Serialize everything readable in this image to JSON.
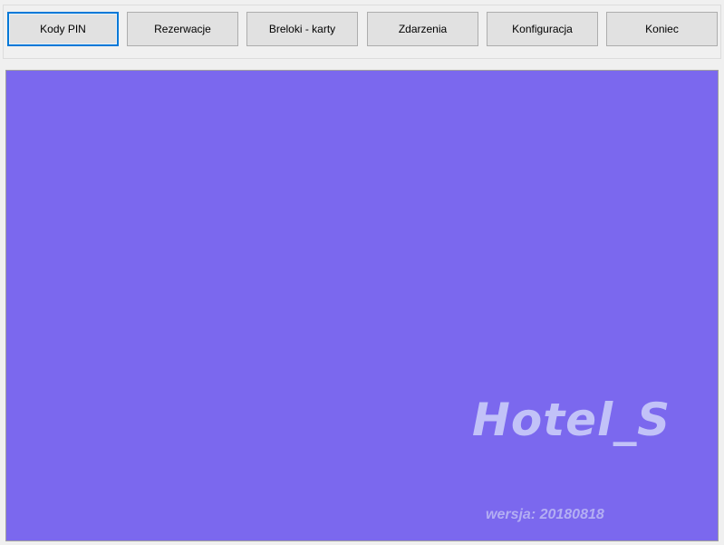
{
  "toolbar": {
    "buttons": [
      {
        "label": "Kody PIN",
        "active": true
      },
      {
        "label": "Rezerwacje"
      },
      {
        "label": "Breloki - karty"
      },
      {
        "label": "Zdarzenia"
      },
      {
        "label": "Konfiguracja"
      },
      {
        "label": "Koniec"
      }
    ]
  },
  "splash": {
    "title": "Hotel_S",
    "version": "wersja: 20180818"
  },
  "colors": {
    "splash_background": "#7b68ee",
    "title_text": "#c2c2f8",
    "version_text": "#b3aef3",
    "active_border": "#0078d7"
  }
}
